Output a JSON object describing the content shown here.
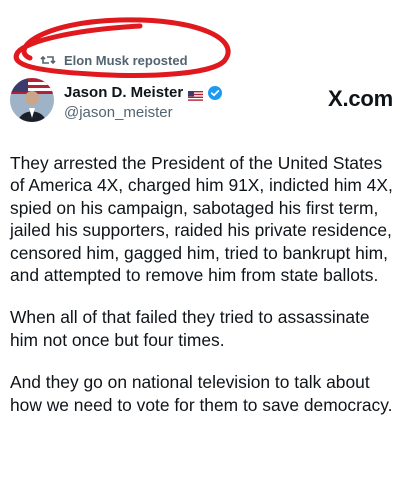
{
  "repost": {
    "icon": "repost-icon",
    "text": "Elon Musk reposted"
  },
  "annotation": {
    "shape": "hand-drawn ellipse",
    "color": "#e0191f"
  },
  "author": {
    "name": "Jason D. Meister",
    "handle": "@jason_meister",
    "flag_icon": "us-flag-icon",
    "verified_icon": "verified-badge-icon",
    "verified_color": "#1d9bf0"
  },
  "site": "X.com",
  "post": {
    "paragraphs": [
      "They arrested the President of the United States of America 4X, charged him 91X, indicted him 4X, spied on his campaign, sabotaged his first term, jailed his supporters, raided his private residence, censored him, gagged him, tried to bankrupt him, and attempted to remove him from state ballots.",
      "When all of that failed they tried to assassinate him not once but four times.",
      "And they go on national television to talk about how we need to vote for them to save democracy."
    ]
  }
}
